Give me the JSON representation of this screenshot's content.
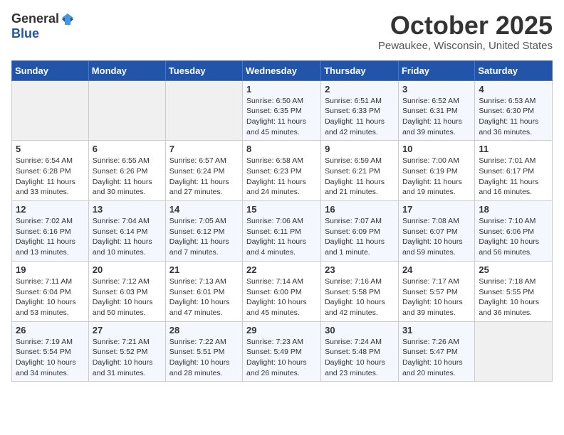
{
  "header": {
    "logo_general": "General",
    "logo_blue": "Blue",
    "month_title": "October 2025",
    "location": "Pewaukee, Wisconsin, United States"
  },
  "weekdays": [
    "Sunday",
    "Monday",
    "Tuesday",
    "Wednesday",
    "Thursday",
    "Friday",
    "Saturday"
  ],
  "weeks": [
    [
      {
        "day": "",
        "info": ""
      },
      {
        "day": "",
        "info": ""
      },
      {
        "day": "",
        "info": ""
      },
      {
        "day": "1",
        "info": "Sunrise: 6:50 AM\nSunset: 6:35 PM\nDaylight: 11 hours and 45 minutes."
      },
      {
        "day": "2",
        "info": "Sunrise: 6:51 AM\nSunset: 6:33 PM\nDaylight: 11 hours and 42 minutes."
      },
      {
        "day": "3",
        "info": "Sunrise: 6:52 AM\nSunset: 6:31 PM\nDaylight: 11 hours and 39 minutes."
      },
      {
        "day": "4",
        "info": "Sunrise: 6:53 AM\nSunset: 6:30 PM\nDaylight: 11 hours and 36 minutes."
      }
    ],
    [
      {
        "day": "5",
        "info": "Sunrise: 6:54 AM\nSunset: 6:28 PM\nDaylight: 11 hours and 33 minutes."
      },
      {
        "day": "6",
        "info": "Sunrise: 6:55 AM\nSunset: 6:26 PM\nDaylight: 11 hours and 30 minutes."
      },
      {
        "day": "7",
        "info": "Sunrise: 6:57 AM\nSunset: 6:24 PM\nDaylight: 11 hours and 27 minutes."
      },
      {
        "day": "8",
        "info": "Sunrise: 6:58 AM\nSunset: 6:23 PM\nDaylight: 11 hours and 24 minutes."
      },
      {
        "day": "9",
        "info": "Sunrise: 6:59 AM\nSunset: 6:21 PM\nDaylight: 11 hours and 21 minutes."
      },
      {
        "day": "10",
        "info": "Sunrise: 7:00 AM\nSunset: 6:19 PM\nDaylight: 11 hours and 19 minutes."
      },
      {
        "day": "11",
        "info": "Sunrise: 7:01 AM\nSunset: 6:17 PM\nDaylight: 11 hours and 16 minutes."
      }
    ],
    [
      {
        "day": "12",
        "info": "Sunrise: 7:02 AM\nSunset: 6:16 PM\nDaylight: 11 hours and 13 minutes."
      },
      {
        "day": "13",
        "info": "Sunrise: 7:04 AM\nSunset: 6:14 PM\nDaylight: 11 hours and 10 minutes."
      },
      {
        "day": "14",
        "info": "Sunrise: 7:05 AM\nSunset: 6:12 PM\nDaylight: 11 hours and 7 minutes."
      },
      {
        "day": "15",
        "info": "Sunrise: 7:06 AM\nSunset: 6:11 PM\nDaylight: 11 hours and 4 minutes."
      },
      {
        "day": "16",
        "info": "Sunrise: 7:07 AM\nSunset: 6:09 PM\nDaylight: 11 hours and 1 minute."
      },
      {
        "day": "17",
        "info": "Sunrise: 7:08 AM\nSunset: 6:07 PM\nDaylight: 10 hours and 59 minutes."
      },
      {
        "day": "18",
        "info": "Sunrise: 7:10 AM\nSunset: 6:06 PM\nDaylight: 10 hours and 56 minutes."
      }
    ],
    [
      {
        "day": "19",
        "info": "Sunrise: 7:11 AM\nSunset: 6:04 PM\nDaylight: 10 hours and 53 minutes."
      },
      {
        "day": "20",
        "info": "Sunrise: 7:12 AM\nSunset: 6:03 PM\nDaylight: 10 hours and 50 minutes."
      },
      {
        "day": "21",
        "info": "Sunrise: 7:13 AM\nSunset: 6:01 PM\nDaylight: 10 hours and 47 minutes."
      },
      {
        "day": "22",
        "info": "Sunrise: 7:14 AM\nSunset: 6:00 PM\nDaylight: 10 hours and 45 minutes."
      },
      {
        "day": "23",
        "info": "Sunrise: 7:16 AM\nSunset: 5:58 PM\nDaylight: 10 hours and 42 minutes."
      },
      {
        "day": "24",
        "info": "Sunrise: 7:17 AM\nSunset: 5:57 PM\nDaylight: 10 hours and 39 minutes."
      },
      {
        "day": "25",
        "info": "Sunrise: 7:18 AM\nSunset: 5:55 PM\nDaylight: 10 hours and 36 minutes."
      }
    ],
    [
      {
        "day": "26",
        "info": "Sunrise: 7:19 AM\nSunset: 5:54 PM\nDaylight: 10 hours and 34 minutes."
      },
      {
        "day": "27",
        "info": "Sunrise: 7:21 AM\nSunset: 5:52 PM\nDaylight: 10 hours and 31 minutes."
      },
      {
        "day": "28",
        "info": "Sunrise: 7:22 AM\nSunset: 5:51 PM\nDaylight: 10 hours and 28 minutes."
      },
      {
        "day": "29",
        "info": "Sunrise: 7:23 AM\nSunset: 5:49 PM\nDaylight: 10 hours and 26 minutes."
      },
      {
        "day": "30",
        "info": "Sunrise: 7:24 AM\nSunset: 5:48 PM\nDaylight: 10 hours and 23 minutes."
      },
      {
        "day": "31",
        "info": "Sunrise: 7:26 AM\nSunset: 5:47 PM\nDaylight: 10 hours and 20 minutes."
      },
      {
        "day": "",
        "info": ""
      }
    ]
  ]
}
